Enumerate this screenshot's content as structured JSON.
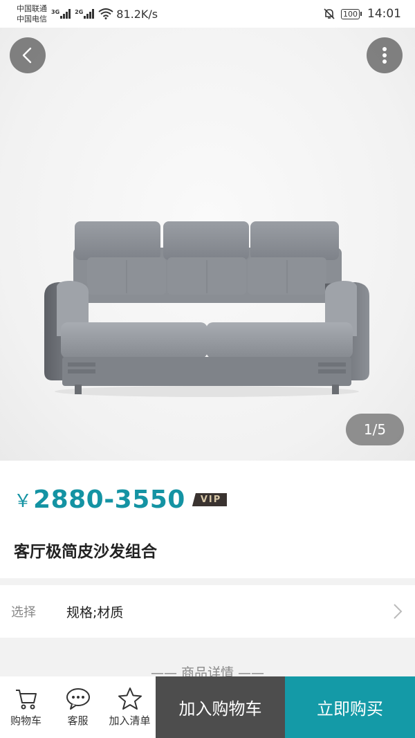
{
  "status_bar": {
    "carrier1": "中国联通",
    "carrier2": "中国电信",
    "sig1_gen": "3G",
    "sig2_gen": "2G",
    "speed": "81.2K/s",
    "battery": "100",
    "time": "14:01"
  },
  "gallery": {
    "counter": "1/5"
  },
  "product": {
    "price_currency": "￥",
    "price": "2880-3550",
    "vip_badge": "VIP",
    "title": "客厅极简皮沙发组合"
  },
  "options": {
    "label": "选择",
    "value": "规格;材质"
  },
  "details": {
    "heading": "—— 商品详情 ——"
  },
  "bottom_bar": {
    "cart_label": "购物车",
    "service_label": "客服",
    "wishlist_label": "加入清单",
    "add_to_cart": "加入购物车",
    "buy_now": "立即购买"
  }
}
